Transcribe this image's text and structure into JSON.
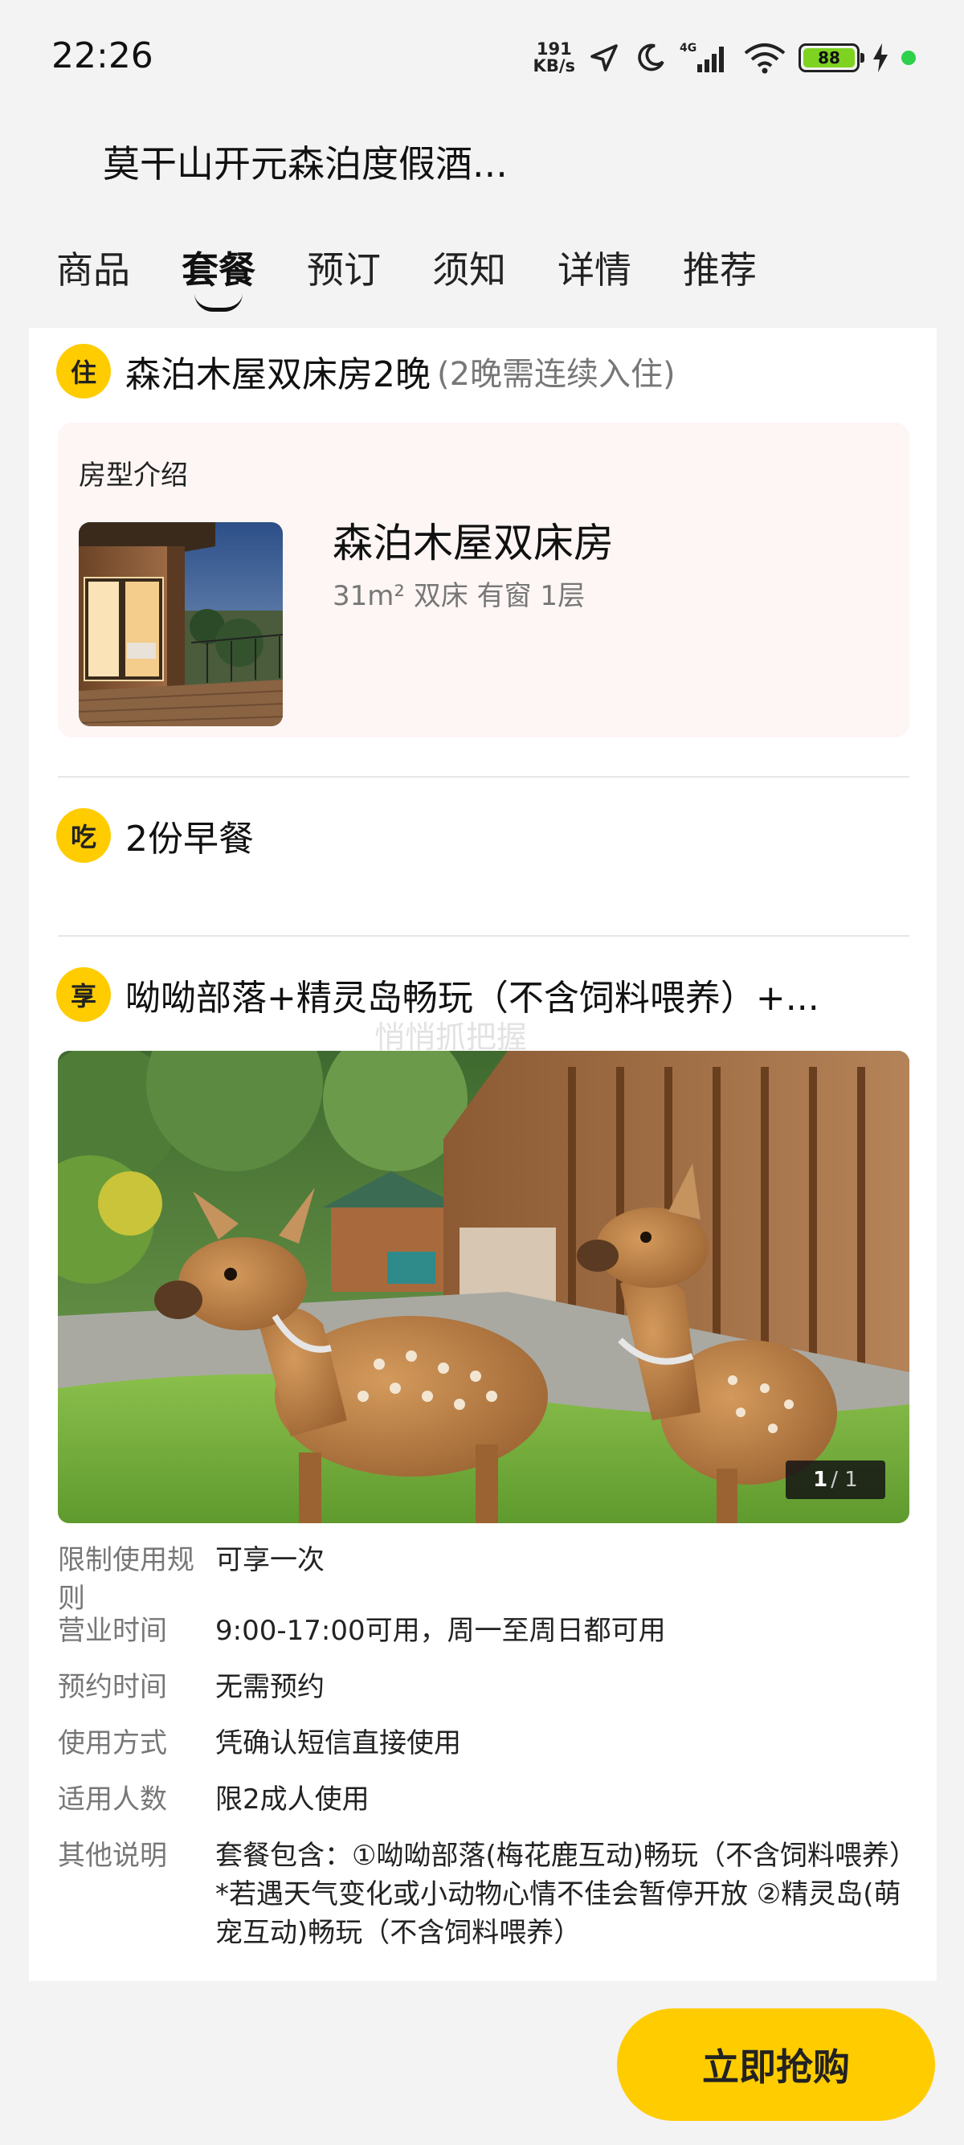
{
  "status_bar": {
    "time": "22:26",
    "net_speed_value": "191",
    "net_speed_unit": "KB/s",
    "network_type": "4G",
    "battery": "88",
    "icons": [
      "location-arrow-icon",
      "moon-icon",
      "signal-icon",
      "wifi-icon",
      "battery-icon",
      "charging-icon"
    ]
  },
  "header": {
    "title": "莫干山开元森泊度假酒..."
  },
  "tabs": [
    {
      "label": "商品",
      "active": false
    },
    {
      "label": "套餐",
      "active": true
    },
    {
      "label": "预订",
      "active": false
    },
    {
      "label": "须知",
      "active": false
    },
    {
      "label": "详情",
      "active": false
    },
    {
      "label": "推荐",
      "active": false
    }
  ],
  "package": {
    "stay": {
      "badge": "住",
      "title": "森泊木屋双床房2晚",
      "note": "(2晚需连续入住)",
      "room_intro_label": "房型介绍",
      "room_name": "森泊木屋双床房",
      "room_spec": "31m² 双床 有窗 1层"
    },
    "eat": {
      "badge": "吃",
      "title": "2份早餐"
    },
    "enjoy": {
      "badge": "享",
      "title": "呦呦部落+精灵岛畅玩（不含饲料喂养）+...",
      "watermark": "悄悄抓把握",
      "photo_counter_current": "1",
      "photo_counter_total": "/ 1"
    }
  },
  "rules": [
    {
      "key": "限制使用规则",
      "value": "可享一次"
    },
    {
      "key": "营业时间",
      "value": "9:00-17:00可用，周一至周日都可用"
    },
    {
      "key": "预约时间",
      "value": "无需预约"
    },
    {
      "key": "使用方式",
      "value": "凭确认短信直接使用"
    },
    {
      "key": "适用人数",
      "value": "限2成人使用"
    },
    {
      "key": "其他说明",
      "value": "套餐包含：①呦呦部落(梅花鹿互动)畅玩（不含饲料喂养）*若遇天气变化或小动物心情不佳会暂停开放 ②精灵岛(萌宠互动)畅玩（不含饲料喂养）"
    }
  ],
  "footer": {
    "buy_label": "立即抢购"
  },
  "colors": {
    "accent": "#ffcc00",
    "background": "#f3f3f3",
    "room_box": "#fdf6f4"
  }
}
